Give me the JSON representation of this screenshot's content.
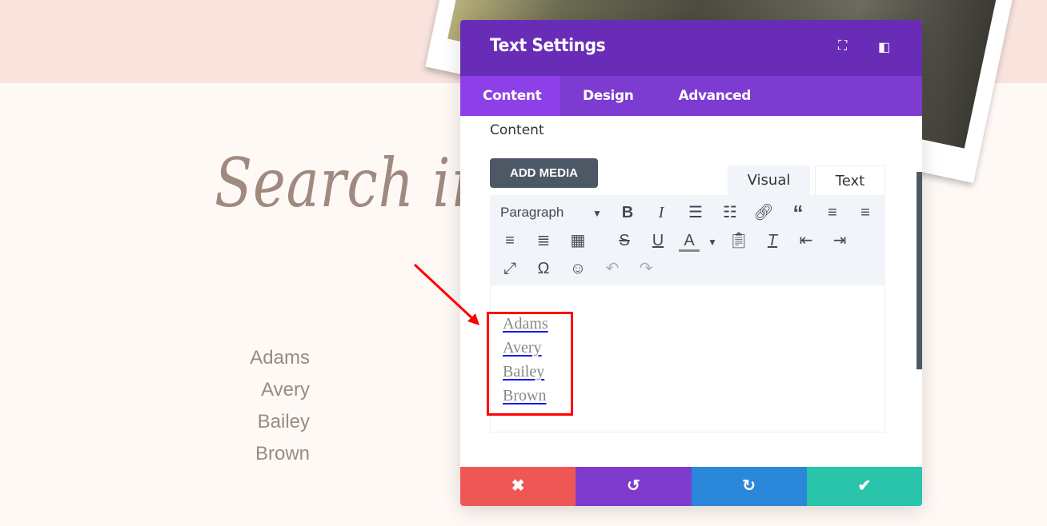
{
  "page": {
    "heading": "Search ima",
    "names": [
      "Adams",
      "Avery",
      "Bailey",
      "Brown"
    ]
  },
  "panel": {
    "title": "Text Settings",
    "tabs": [
      {
        "label": "Content",
        "active": true
      },
      {
        "label": "Design"
      },
      {
        "label": "Advanced"
      }
    ],
    "section_label": "Content",
    "add_media": "ADD MEDIA",
    "editor_tabs": {
      "visual": "Visual",
      "text": "Text",
      "active": "Visual"
    },
    "format_select": "Paragraph",
    "content_links": [
      "Adams",
      "Avery",
      "Bailey",
      "Brown"
    ],
    "footer": [
      {
        "icon": "close-icon",
        "color": "#ef5757"
      },
      {
        "icon": "undo-icon",
        "color": "#7e3bce"
      },
      {
        "icon": "redo-icon",
        "color": "#2b87da"
      },
      {
        "icon": "check-icon",
        "color": "#29c4a9"
      }
    ]
  },
  "colors": {
    "header": "#682cb6",
    "tabs": "#7c3bd1",
    "active_tab": "#8e40e8",
    "annotation": "#ff0000"
  }
}
